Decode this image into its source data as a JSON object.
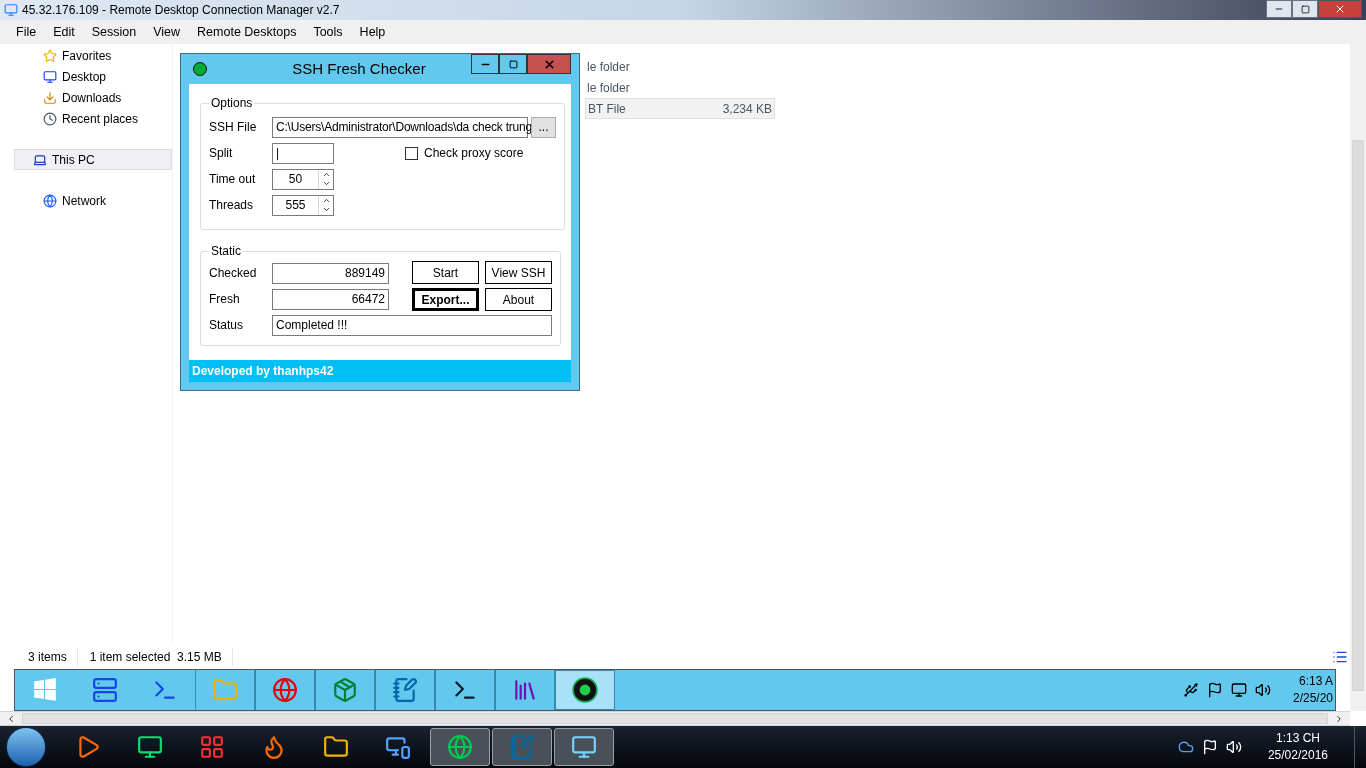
{
  "window": {
    "title": "45.32.176.109 - Remote Desktop Connection Manager v2.7"
  },
  "menu": [
    "File",
    "Edit",
    "Session",
    "View",
    "Remote Desktops",
    "Tools",
    "Help"
  ],
  "explorer": {
    "nav": [
      {
        "label": "Favorites",
        "kind": "star",
        "selected": false
      },
      {
        "label": "Desktop",
        "kind": "desktop",
        "selected": false
      },
      {
        "label": "Downloads",
        "kind": "downloads",
        "selected": false
      },
      {
        "label": "Recent places",
        "kind": "recent",
        "selected": false
      },
      {
        "label": "This PC",
        "kind": "pc",
        "selected": true
      },
      {
        "label": "Network",
        "kind": "network",
        "selected": false
      }
    ],
    "files": [
      {
        "type": "le folder",
        "selected": false
      },
      {
        "type": "le folder",
        "selected": false
      },
      {
        "type": "BT File",
        "size": "3,234 KB",
        "selected": true
      }
    ],
    "status_bar": [
      "3 items",
      "1 item selected  3.15 MB"
    ]
  },
  "dialog": {
    "title": "SSH Fresh Checker",
    "options": {
      "title": "Options",
      "ssh_file_label": "SSH File",
      "ssh_file": "C:\\Users\\Administrator\\Downloads\\da check trung",
      "browse": "...",
      "split_label": "Split",
      "split": "|",
      "proxy": {
        "label": "Check proxy score",
        "checked": false
      },
      "timeout_label": "Time out",
      "timeout": "50",
      "threads_label": "Threads",
      "threads": "555"
    },
    "static": {
      "title": "Static",
      "checked_label": "Checked",
      "checked": "889149",
      "fresh_label": "Fresh",
      "fresh": "66472",
      "status_label": "Status",
      "status": "Completed !!!",
      "buttons": [
        {
          "label": "Start",
          "focused": false
        },
        {
          "label": "View SSH",
          "focused": false
        },
        {
          "label": "Export...",
          "focused": true
        },
        {
          "label": "About",
          "focused": false
        }
      ]
    },
    "footer": "Developed by thanhps42"
  },
  "remote_taskbar": {
    "apps": [
      {
        "kind": "start",
        "selected": false
      },
      {
        "kind": "server",
        "selected": false
      },
      {
        "kind": "powershell",
        "selected": false
      },
      {
        "kind": "explorer",
        "selected": false
      },
      {
        "kind": "chrome",
        "selected": false
      },
      {
        "kind": "box",
        "selected": false
      },
      {
        "kind": "notepad",
        "selected": false
      },
      {
        "kind": "terminal",
        "selected": false
      },
      {
        "kind": "archive",
        "selected": false
      },
      {
        "kind": "orb",
        "selected": true
      }
    ],
    "time": "6:13 A",
    "date": "2/25/20"
  },
  "taskbar": {
    "apps": [
      {
        "kind": "media",
        "active": false
      },
      {
        "kind": "monitor",
        "active": false
      },
      {
        "kind": "grid",
        "active": false
      },
      {
        "kind": "firefox",
        "active": false
      },
      {
        "kind": "explorer",
        "active": false
      },
      {
        "kind": "remote",
        "active": false
      },
      {
        "kind": "coccoc",
        "active": true
      },
      {
        "kind": "notepad",
        "active": true
      },
      {
        "kind": "rdcman",
        "active": true
      }
    ],
    "time": "1:13 CH",
    "date": "25/02/2016"
  }
}
